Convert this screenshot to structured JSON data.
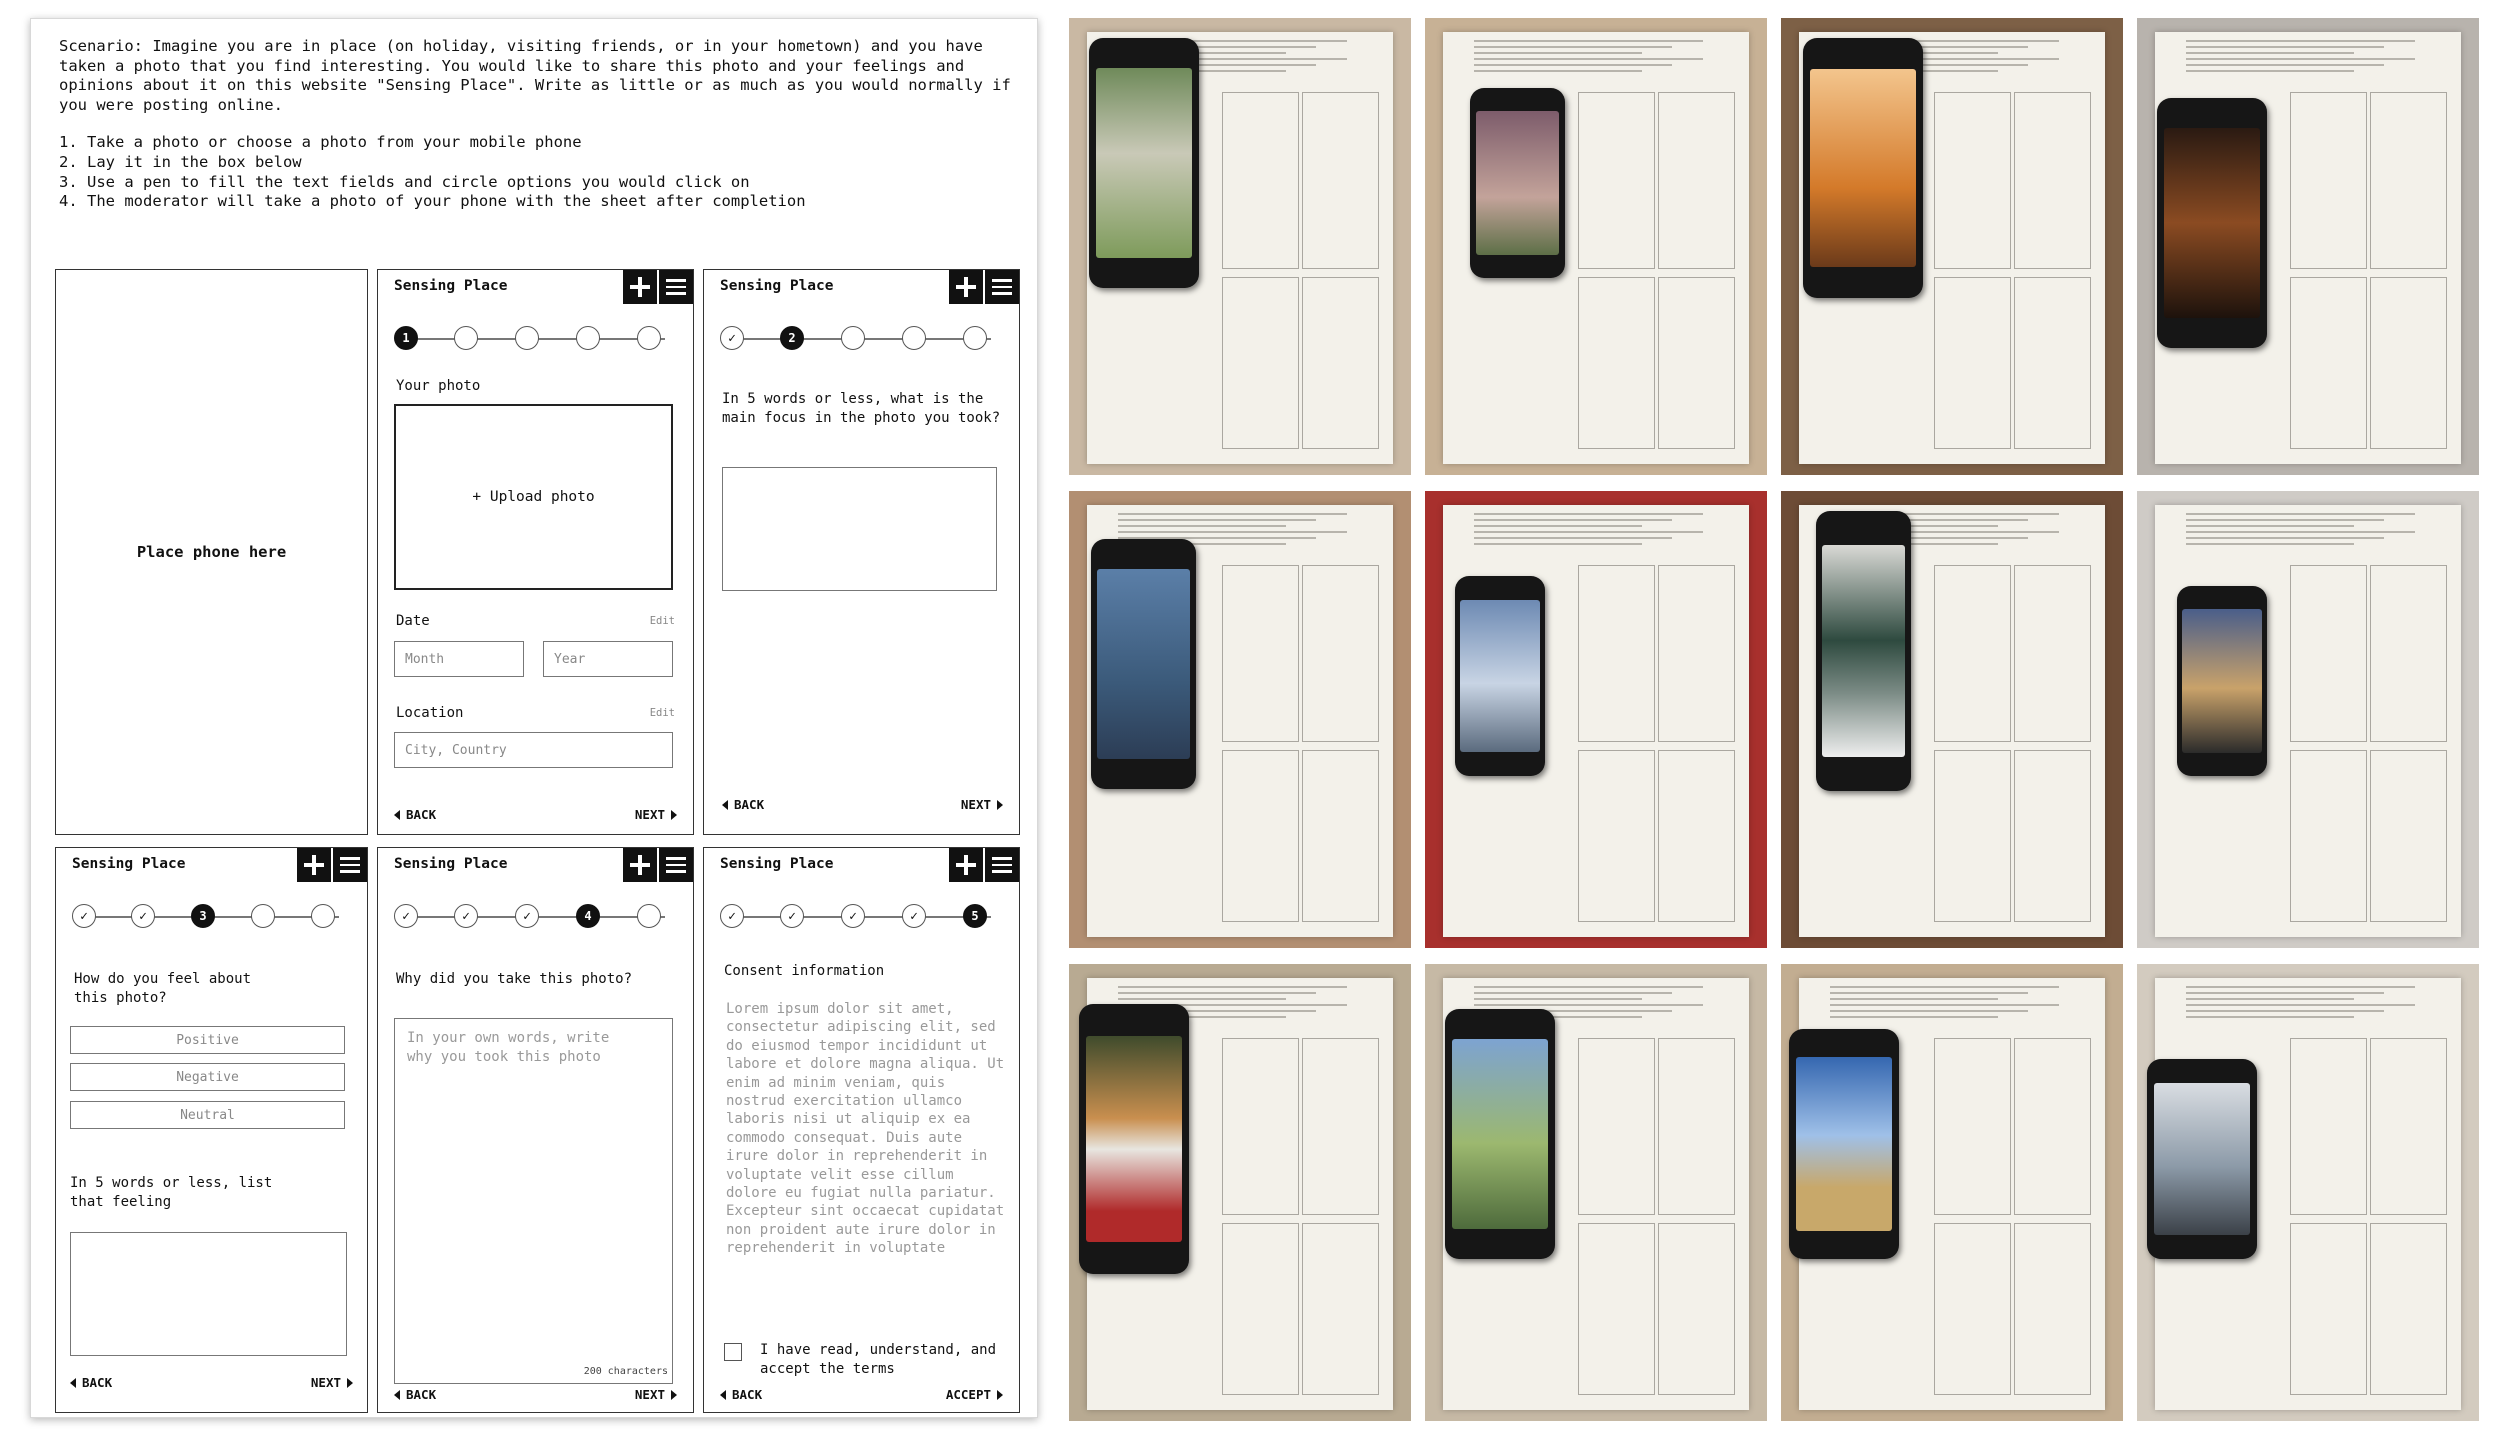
{
  "instructions": {
    "scenario": "Scenario: Imagine you are in place (on holiday, visiting friends, or in your hometown) and you have taken a photo that you find interesting. You would like to share this photo and your feelings and opinions about it on this website \"Sensing Place\". Write as little or as much as you would normally if you were posting online.",
    "steps": [
      "1. Take a photo or choose a photo from your mobile phone",
      "2. Lay it in the box below",
      "3. Use a pen to fill the text fields and circle options you would click on",
      "4. The moderator will take a photo of your phone with the sheet after completion"
    ]
  },
  "placeholder": {
    "label": "Place phone here"
  },
  "app_title": "Sensing Place",
  "icons": {
    "add": "plus-icon",
    "menu": "hamburger-menu-icon",
    "done": "check-icon",
    "back": "caret-left-icon",
    "next": "caret-right-icon"
  },
  "nav": {
    "back": "BACK",
    "next": "NEXT",
    "accept": "ACCEPT"
  },
  "step1": {
    "current_step": "1",
    "your_photo_label": "Your photo",
    "upload_label": "+ Upload photo",
    "date_label": "Date",
    "edit_label": "Edit",
    "month_placeholder": "Month",
    "year_placeholder": "Year",
    "location_label": "Location",
    "location_placeholder": "City, Country"
  },
  "step2": {
    "current_step": "2",
    "question": "In 5 words or less, what is the main focus in the photo you took?"
  },
  "step3": {
    "current_step": "3",
    "question": "How do you feel about this photo?",
    "options": [
      "Positive",
      "Negative",
      "Neutral"
    ],
    "followup": "In 5 words or less, list that feeling"
  },
  "step4": {
    "current_step": "4",
    "question": "Why did you take this photo?",
    "placeholder": "In your own words, write why you took this photo",
    "char_limit": "200 characters"
  },
  "step5": {
    "current_step": "5",
    "heading": "Consent information",
    "body": "Lorem ipsum dolor sit amet, consectetur adipiscing elit, sed do eiusmod tempor incididunt ut labore et dolore magna aliqua. Ut enim ad minim veniam, quis nostrud exercitation ullamco laboris nisi ut aliquip ex ea commodo consequat. Duis aute irure dolor in reprehenderit in voluptate velit esse cillum dolore eu fugiat nulla pariatur. Excepteur sint occaecat cupidatat non proident aute irure dolor in reprehenderit in voluptate",
    "agree_label": "I have read, understand, and accept the terms"
  }
}
